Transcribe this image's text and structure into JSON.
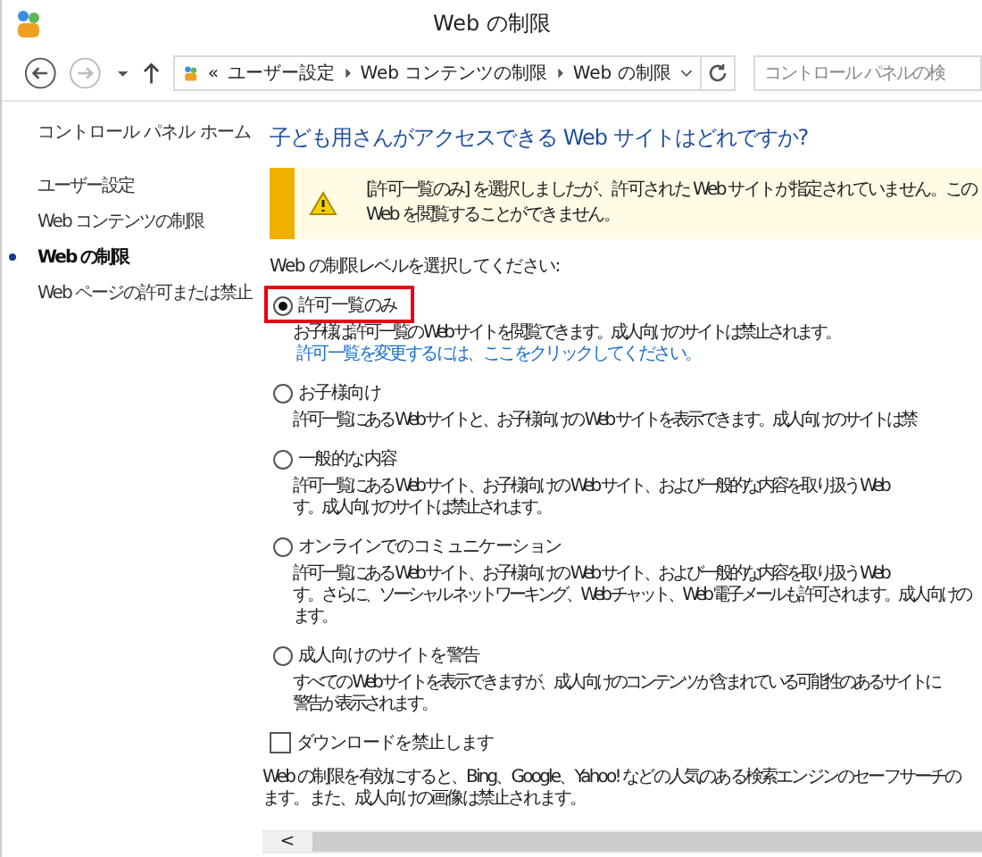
{
  "window": {
    "title": "Web の制限"
  },
  "address_bar": {
    "crumbs": [
      "«",
      "ユーザー設定",
      "Web コンテンツの制限",
      "Web の制限"
    ]
  },
  "search": {
    "placeholder": "コントロール パネルの検"
  },
  "sidebar": {
    "home": "コントロール パネル ホーム",
    "items": [
      {
        "label": "ユーザー設定",
        "selected": false
      },
      {
        "label": "Web コンテンツの制限",
        "selected": false
      },
      {
        "label": "Web の制限",
        "selected": true
      },
      {
        "label": "Web ページの許可または禁止",
        "selected": false
      }
    ]
  },
  "heading": "子ども用さんがアクセスできる Web サイトはどれですか?",
  "warning": [
    "[許可一覧のみ] を選択しましたが、許可された Web サイトが指定されていません。この",
    "Web を閲覧することができません。"
  ],
  "level_prompt": "Web の制限レベルを選択してください:",
  "options": [
    {
      "label": "許可一覧のみ",
      "selected": true,
      "lines": [
        "お子様は許可一覧の Web サイトを閲覧できます。成人向けのサイトは禁止されます。"
      ],
      "link": "許可一覧を変更するには、ここをクリックしてください。"
    },
    {
      "label": "お子様向け",
      "selected": false,
      "lines": [
        "許可一覧にある Web サイトと、お子様向けの Web サイトを表示できます。成人向けのサイトは禁"
      ]
    },
    {
      "label": "一般的な内容",
      "selected": false,
      "lines": [
        "許可一覧にある Web サイト、お子様向けの Web サイト、および一般的な内容を取り扱う Web",
        "す。成人向けのサイトは禁止されます。"
      ]
    },
    {
      "label": "オンラインでのコミュニケーション",
      "selected": false,
      "lines": [
        "許可一覧にある Web サイト、お子様向けの Web サイト、および一般的な内容を取り扱う Web",
        "す。さらに、ソーシャル ネットワーキング、Web チャット、Web 電子メールも許可されます。成人向けの",
        "ます。"
      ]
    },
    {
      "label": "成人向けのサイトを警告",
      "selected": false,
      "lines": [
        "すべての Web サイトを表示できますが、成人向けのコンテンツが含まれている可能性のあるサイトに",
        "警告が表示されます。"
      ]
    }
  ],
  "download_block": {
    "label": "ダウンロードを禁止します",
    "checked": false
  },
  "footer_note": [
    "Web の制限を有効にすると、Bing、Google、Yahoo! などの人気のある検索エンジンのセーフサーチの",
    "ます。また、成人向けの画像は禁止されます。"
  ],
  "scrollbar_arrow": "<"
}
